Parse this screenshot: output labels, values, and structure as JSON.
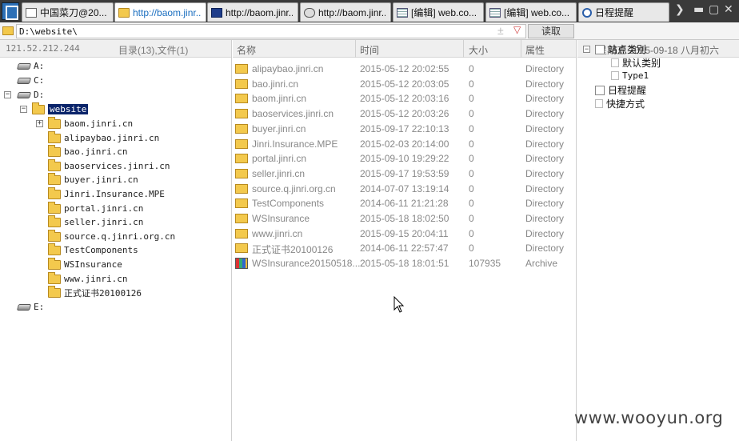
{
  "tabs": [
    {
      "label": "中国菜刀@20...",
      "icon": "page-icon"
    },
    {
      "label": "http://baom.jinr...",
      "icon": "folder-icon",
      "active": true
    },
    {
      "label": "http://baom.jinr...",
      "icon": "browser-icon"
    },
    {
      "label": "http://baom.jinr...",
      "icon": "database-icon"
    },
    {
      "label": "[编辑] web.co...",
      "icon": "document-icon"
    },
    {
      "label": "[编辑] web.co...",
      "icon": "document-icon"
    },
    {
      "label": "日程提醒",
      "icon": "clock-icon"
    }
  ],
  "address": {
    "path": "D:\\website\\",
    "read_label": "读取",
    "plus_glyph": "±",
    "drop_glyph": "▽"
  },
  "left_panel": {
    "ip": "121.52.212.244",
    "summary": "目录(13),文件(1)",
    "drives": [
      "A:",
      "C:",
      "D:",
      "E:"
    ],
    "selected_folder": "website",
    "folders": [
      "baom.jinri.cn",
      "alipaybao.jinri.cn",
      "bao.jinri.cn",
      "baoservices.jinri.cn",
      "buyer.jinri.cn",
      "Jinri.Insurance.MPE",
      "portal.jinri.cn",
      "seller.jinri.cn",
      "source.q.jinri.org.cn",
      "TestComponents",
      "WSInsurance",
      "www.jinri.cn",
      "正式证书20100126"
    ]
  },
  "file_list": {
    "headers": {
      "name": "名称",
      "time": "时间",
      "size": "大小",
      "attr": "属性"
    },
    "rows": [
      {
        "name": "alipaybao.jinri.cn",
        "time": "2015-05-12 20:02:55",
        "size": "0",
        "attr": "Directory",
        "type": "folder"
      },
      {
        "name": "bao.jinri.cn",
        "time": "2015-05-12 20:03:05",
        "size": "0",
        "attr": "Directory",
        "type": "folder"
      },
      {
        "name": "baom.jinri.cn",
        "time": "2015-05-12 20:03:16",
        "size": "0",
        "attr": "Directory",
        "type": "folder"
      },
      {
        "name": "baoservices.jinri.cn",
        "time": "2015-05-12 20:03:26",
        "size": "0",
        "attr": "Directory",
        "type": "folder"
      },
      {
        "name": "buyer.jinri.cn",
        "time": "2015-09-17 22:10:13",
        "size": "0",
        "attr": "Directory",
        "type": "folder"
      },
      {
        "name": "Jinri.Insurance.MPE",
        "time": "2015-02-03 20:14:00",
        "size": "0",
        "attr": "Directory",
        "type": "folder"
      },
      {
        "name": "portal.jinri.cn",
        "time": "2015-09-10 19:29:22",
        "size": "0",
        "attr": "Directory",
        "type": "folder"
      },
      {
        "name": "seller.jinri.cn",
        "time": "2015-09-17 19:53:59",
        "size": "0",
        "attr": "Directory",
        "type": "folder"
      },
      {
        "name": "source.q.jinri.org.cn",
        "time": "2014-07-07 13:19:14",
        "size": "0",
        "attr": "Directory",
        "type": "folder"
      },
      {
        "name": "TestComponents",
        "time": "2014-06-11 21:21:28",
        "size": "0",
        "attr": "Directory",
        "type": "folder"
      },
      {
        "name": "WSInsurance",
        "time": "2015-05-18 18:02:50",
        "size": "0",
        "attr": "Directory",
        "type": "folder"
      },
      {
        "name": "www.jinri.cn",
        "time": "2015-09-15 20:04:11",
        "size": "0",
        "attr": "Directory",
        "type": "folder"
      },
      {
        "name": "正式证书20100126",
        "time": "2014-06-11 22:57:47",
        "size": "0",
        "attr": "Directory",
        "type": "folder"
      },
      {
        "name": "WSInsurance20150518....",
        "time": "2015-05-18 18:01:51",
        "size": "107935",
        "attr": "Archive",
        "type": "archive"
      }
    ]
  },
  "right_panel": {
    "date": "星期五 2015-09-18 八月初六",
    "site_category": "站点类别",
    "default_category": "默认类别",
    "type1": "Type1",
    "schedule": "日程提醒",
    "shortcuts": "快捷方式"
  },
  "watermark": "www.wooyun.org"
}
